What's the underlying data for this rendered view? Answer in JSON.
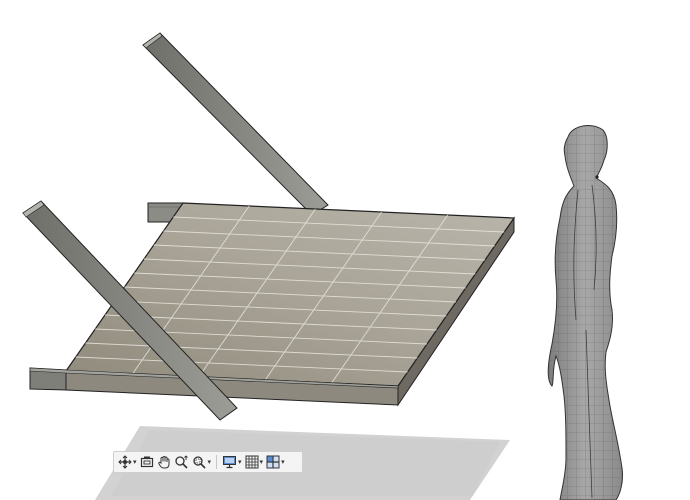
{
  "viewport": {
    "scene": [
      "solar-panel-model",
      "support-beams",
      "human-figure-reference",
      "ground-shadow"
    ]
  },
  "navbar": {
    "tools": [
      {
        "name": "orbit",
        "icon": "orbit-icon",
        "has_menu": true
      },
      {
        "name": "look-at",
        "icon": "look-at-icon",
        "has_menu": false
      },
      {
        "name": "pan",
        "icon": "pan-hand-icon",
        "has_menu": false
      },
      {
        "name": "zoom",
        "icon": "zoom-icon",
        "has_menu": false
      },
      {
        "name": "fit",
        "icon": "zoom-window-icon",
        "has_menu": true
      },
      {
        "name": "display-settings",
        "icon": "display-settings-icon",
        "has_menu": true
      },
      {
        "name": "grid-and-snaps",
        "icon": "grid-icon",
        "has_menu": true
      },
      {
        "name": "viewports",
        "icon": "viewports-icon",
        "has_menu": true
      }
    ]
  },
  "colors": {
    "background": "#ffffff",
    "panel_surface": "#a19c8f",
    "panel_grid": "#e8e6e0",
    "beam": "#8a8a84",
    "shadow": "#d4d4d4",
    "figure": "#9a9a9a"
  }
}
